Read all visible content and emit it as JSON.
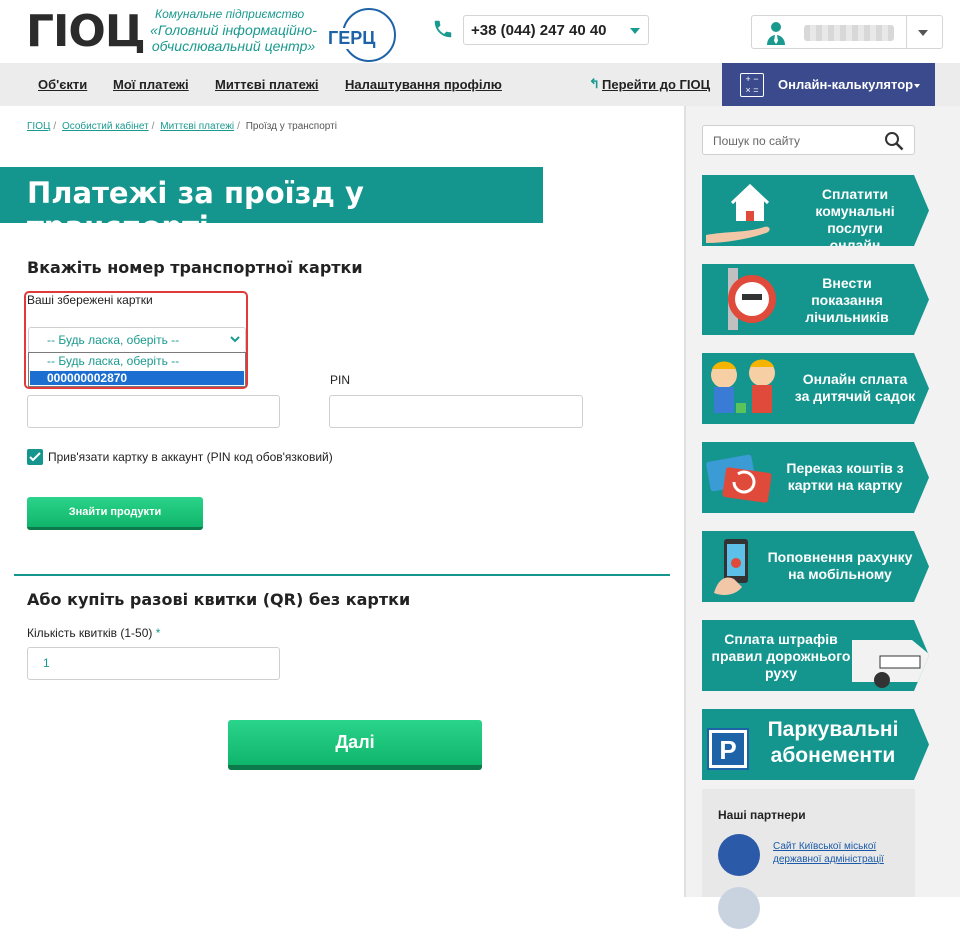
{
  "header": {
    "logo": "ГІОЦ",
    "org_subtitle": "Комунальне підприємство",
    "org_name": "«Головний інформаційно-обчислювальний центр»",
    "partner_logo": "ГЕРЦ",
    "phone": "+38 (044) 247 40 40"
  },
  "nav": {
    "items": [
      "Об'єкти",
      "Мої платежі",
      "Миттєві платежі",
      "Налаштування профілю"
    ],
    "goto": "Перейти до ГІОЦ",
    "calculator": "Онлайн-калькулятор"
  },
  "breadcrumbs": [
    "ГІОЦ",
    "Особистий кабінет",
    "Миттєві платежі",
    "Проїзд у транспорті"
  ],
  "page_title": "Платежі за проїзд у транспорті",
  "card_section": {
    "heading": "Вкажіть номер транспортної картки",
    "saved_label": "Ваші збережені картки",
    "select_value": "-- Будь ласка, оберіть --",
    "dropdown_options": [
      "-- Будь ласка, оберіть --",
      "000000002870"
    ],
    "pin_label": "PIN",
    "bind_label": "Прив'язати картку в аккаунт (PIN код обов'язковий)",
    "bind_checked": true,
    "find_button": "Знайти продукти"
  },
  "qr_section": {
    "heading": "Або купіть разові квитки (QR) без картки",
    "qty_label": "Кількість квитків (1-50)",
    "required_mark": "*",
    "qty_value": "1",
    "next_button": "Далі"
  },
  "sidebar": {
    "search_placeholder": "Пошук по сайту",
    "promos": [
      "Сплатити комунальні послуги онлайн",
      "Внести показання лічильників",
      "Онлайн сплата за дитячий садок",
      "Переказ коштів з картки на картку",
      "Поповнення рахунку на мобільному",
      "Сплата штрафів правил дорожнього руху",
      "Паркувальні абонементи"
    ],
    "partners_heading": "Наші партнери",
    "partner_link": "Сайт Київської міської державної адміністрації"
  },
  "colors": {
    "teal": "#14958d",
    "green": "#10b56c",
    "navy": "#3a4a8c",
    "highlight": "#1c6fd0",
    "error": "#e03a3a"
  }
}
